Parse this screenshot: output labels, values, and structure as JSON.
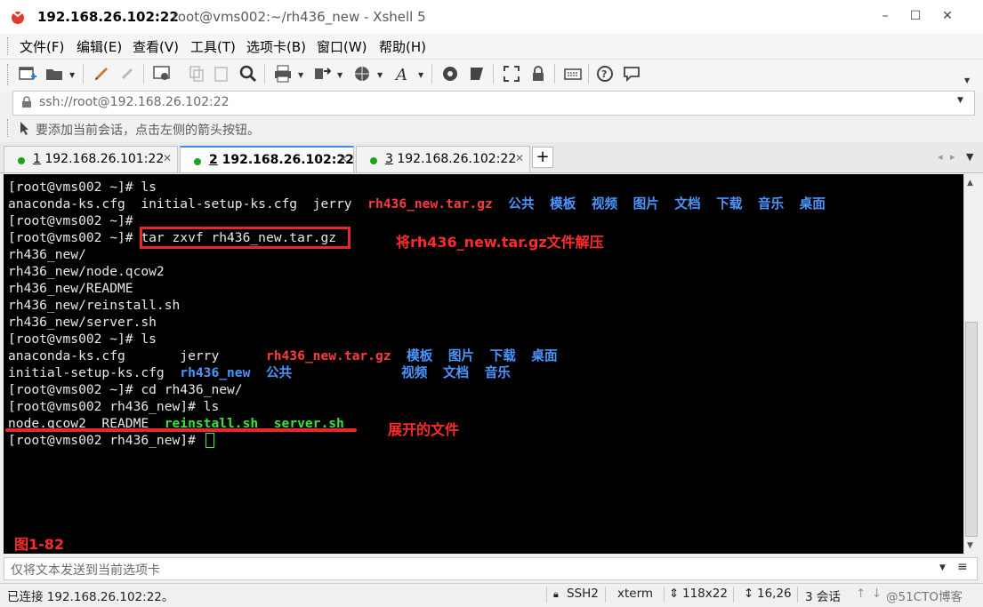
{
  "window": {
    "title_host": "192.168.26.102:22",
    "title_rest": "root@vms002:~/rh436_new - Xshell 5",
    "controls": {
      "minimize": "–",
      "maximize": "☐",
      "close": "✕"
    }
  },
  "menu": [
    {
      "label": "文件(F)"
    },
    {
      "label": "编辑(E)"
    },
    {
      "label": "查看(V)"
    },
    {
      "label": "工具(T)"
    },
    {
      "label": "选项卡(B)"
    },
    {
      "label": "窗口(W)"
    },
    {
      "label": "帮助(H)"
    }
  ],
  "toolbar_icons": [
    "new-session-icon",
    "open-folder-icon",
    "edit-icon",
    "pin-icon",
    "properties-icon",
    "copy-icon",
    "paste-icon",
    "find-icon",
    "print-icon",
    "transfer-icon",
    "globe-icon",
    "font-icon",
    "xftp-icon",
    "xagent-icon",
    "fullscreen-icon",
    "lock-icon",
    "keyboard-icon",
    "help-icon",
    "chat-icon"
  ],
  "address": {
    "value": "ssh://root@192.168.26.102:22"
  },
  "hint": {
    "text": "要添加当前会话，点击左侧的箭头按钮。"
  },
  "tabs": [
    {
      "num": "1",
      "label": " 192.168.26.101:22",
      "active": false
    },
    {
      "num": "2",
      "label": " 192.168.26.102:22",
      "active": true
    },
    {
      "num": "3",
      "label": " 192.168.26.102:22",
      "active": false
    }
  ],
  "terminal": {
    "lines": [
      [
        {
          "t": "[root@vms002 ~]# ls"
        }
      ],
      [
        {
          "t": "anaconda-ks.cfg  initial-setup-ks.cfg  jerry  "
        },
        {
          "t": "rh436_new.tar.gz",
          "c": "red"
        },
        {
          "t": "  "
        },
        {
          "t": "公共  模板  视频  图片  文档  下载  音乐  桌面",
          "c": "blue"
        }
      ],
      [
        {
          "t": "[root@vms002 ~]#"
        }
      ],
      [
        {
          "t": "[root@vms002 ~]# tar zxvf rh436_new.tar.gz"
        }
      ],
      [
        {
          "t": "rh436_new/"
        }
      ],
      [
        {
          "t": "rh436_new/node.qcow2"
        }
      ],
      [
        {
          "t": "rh436_new/README"
        }
      ],
      [
        {
          "t": "rh436_new/reinstall.sh"
        }
      ],
      [
        {
          "t": "rh436_new/server.sh"
        }
      ],
      [
        {
          "t": "[root@vms002 ~]# ls"
        }
      ],
      [
        {
          "t": "anaconda-ks.cfg       jerry      "
        },
        {
          "t": "rh436_new.tar.gz",
          "c": "red"
        },
        {
          "t": "  "
        },
        {
          "t": "模板  图片  下载  桌面",
          "c": "blue"
        }
      ],
      [
        {
          "t": "initial-setup-ks.cfg  "
        },
        {
          "t": "rh436_new",
          "c": "blue"
        },
        {
          "t": "  "
        },
        {
          "t": "公共",
          "c": "blue"
        },
        {
          "t": "              "
        },
        {
          "t": "视频  文档  音乐",
          "c": "blue"
        }
      ],
      [
        {
          "t": "[root@vms002 ~]# cd rh436_new/"
        }
      ],
      [
        {
          "t": "[root@vms002 rh436_new]# ls"
        }
      ],
      [
        {
          "t": "node.qcow2  README  "
        },
        {
          "t": "reinstall.sh",
          "c": "green"
        },
        {
          "t": "  "
        },
        {
          "t": "server.sh",
          "c": "green"
        }
      ],
      [
        {
          "t": "[root@vms002 rh436_new]# "
        }
      ]
    ],
    "annotations": {
      "extract": "将rh436_new.tar.gz文件解压",
      "files": "展开的文件",
      "figure": "图1-82"
    }
  },
  "input_bar": {
    "placeholder": "仅将文本发送到当前选项卡"
  },
  "status": {
    "connection": "已连接 192.168.26.102:22。",
    "protocol": "SSH2",
    "terminal_type": "xterm",
    "size": "118x22",
    "cursor_pos": "16,26",
    "sessions": "3 会话",
    "watermark": "@51CTO博客"
  }
}
